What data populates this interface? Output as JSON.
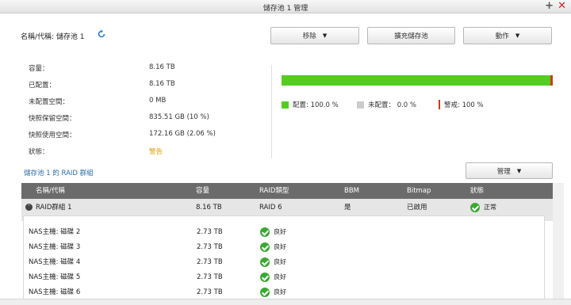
{
  "window": {
    "title": "儲存池 1 管理",
    "add_symbol": "+",
    "close_symbol": "✕"
  },
  "header": {
    "pool_label": "名稱/代稱: 儲存池 1"
  },
  "toolbar": {
    "remove_label": "移除",
    "expand_label": "擴充儲存池",
    "action_label": "動作",
    "caret": "▼"
  },
  "info": {
    "rows": [
      {
        "label": "容量：",
        "value": "8.16 TB"
      },
      {
        "label": "已配置：",
        "value": "8.16 TB"
      },
      {
        "label": "未配置空間：",
        "value": "0 MB"
      },
      {
        "label": "快照保留空間：",
        "value": "835.51 GB (10 %)"
      },
      {
        "label": "快照使用空間：",
        "value": "172.16 GB (2.06 %)"
      },
      {
        "label": "狀態：",
        "value": "警告"
      }
    ]
  },
  "usage": {
    "allocated_fraction": 1.0,
    "colors": {
      "allocated": "#55cc22",
      "unallocated": "#cccccc",
      "threshold": "#d03a1a"
    },
    "legend": [
      {
        "label": "配置: 100.0 %"
      },
      {
        "label": "未配置： 0.0 %"
      },
      {
        "label": "警戒: 100 %"
      }
    ]
  },
  "raid_section": {
    "title": "儲存池 1 的 RAID 群組",
    "manage_label": "管理",
    "columns": [
      "名稱/代稱",
      "容量",
      "RAID類型",
      "BBM",
      "Bitmap",
      "狀態"
    ],
    "group": {
      "name": "RAID群組 1",
      "capacity": "8.16 TB",
      "raid_type": "RAID 6",
      "bbm": "是",
      "bitmap": "已啟用",
      "status": "正常",
      "expand_symbol": "˄"
    },
    "disks": [
      {
        "name": "NAS主機: 磁碟 2",
        "capacity": "2.73 TB",
        "status": "良好"
      },
      {
        "name": "NAS主機: 磁碟 3",
        "capacity": "2.73 TB",
        "status": "良好"
      },
      {
        "name": "NAS主機: 磁碟 4",
        "capacity": "2.73 TB",
        "status": "良好"
      },
      {
        "name": "NAS主機: 磁碟 5",
        "capacity": "2.73 TB",
        "status": "良好"
      },
      {
        "name": "NAS主機: 磁碟 6",
        "capacity": "2.73 TB",
        "status": "良好"
      }
    ]
  }
}
